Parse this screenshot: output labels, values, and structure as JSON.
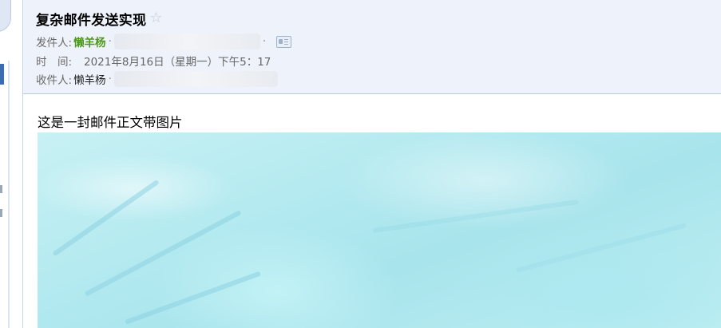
{
  "email": {
    "subject": "复杂邮件发送实现",
    "star_icon": "☆",
    "from": {
      "label": "发件人:",
      "name": "懒羊杨",
      "separator": "·"
    },
    "time": {
      "label": "时　间:",
      "value": "2021年8月16日（星期一）下午5：17"
    },
    "to": {
      "label": "收件人:",
      "name": "懒羊杨",
      "separator": "·"
    },
    "body_text": "这是一封邮件正文带图片"
  },
  "icons": {
    "star": "star-outline-icon",
    "contact_card": "contact-card-icon"
  },
  "colors": {
    "header_bg": "#eef2fb",
    "sender_name": "#4d9a1a",
    "image_tint": "#b4eaf0"
  }
}
